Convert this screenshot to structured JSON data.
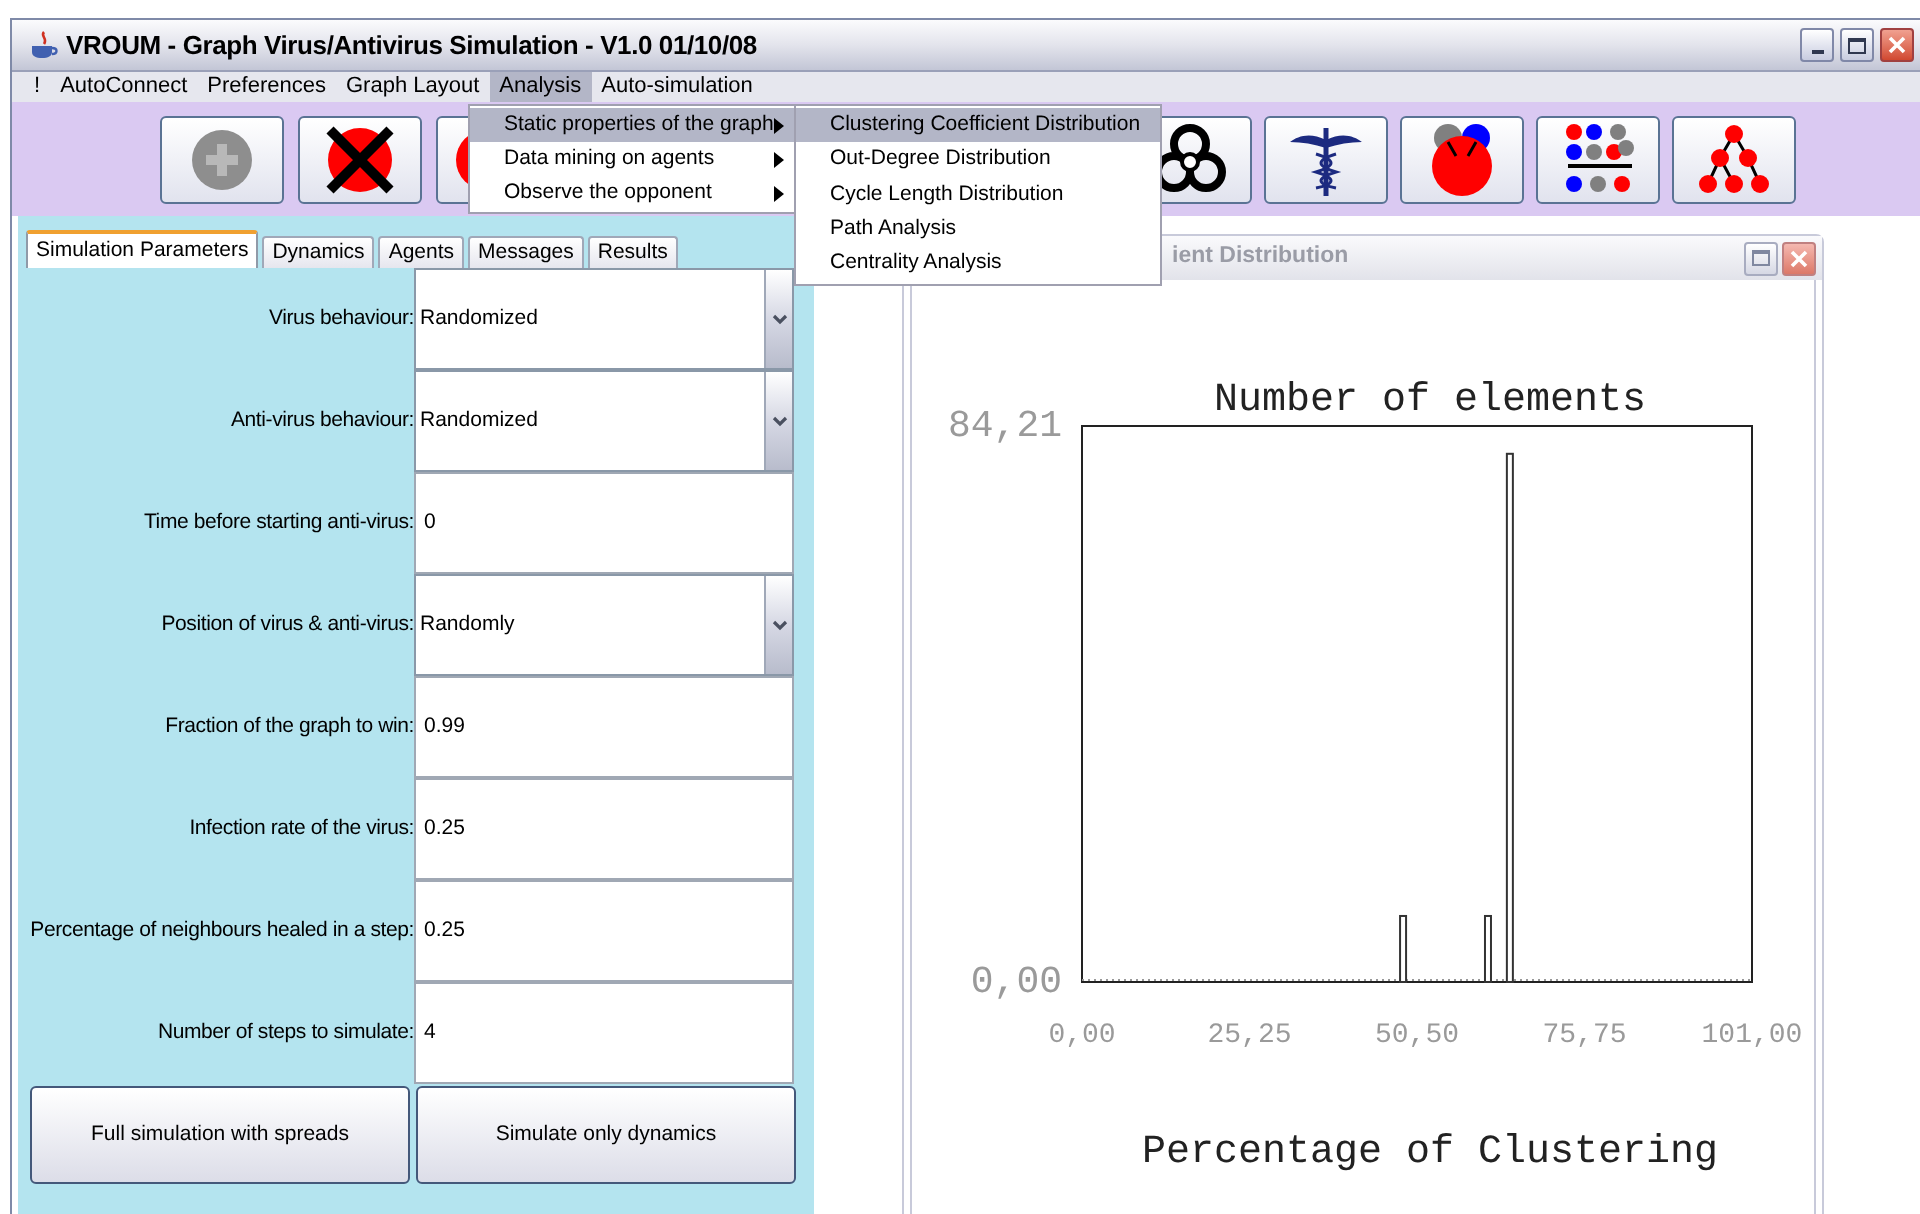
{
  "window": {
    "title": "VROUM - Graph Virus/Antivirus Simulation - V1.0 01/10/08"
  },
  "menu_bar": [
    {
      "label": "!",
      "selected": false
    },
    {
      "label": "AutoConnect",
      "selected": false
    },
    {
      "label": "Preferences",
      "selected": false
    },
    {
      "label": "Graph Layout",
      "selected": false
    },
    {
      "label": "Analysis",
      "selected": true
    },
    {
      "label": "Auto-simulation",
      "selected": false
    }
  ],
  "analysis_menu": [
    {
      "label": "Static properties of the graph",
      "selected": true,
      "submenu": true
    },
    {
      "label": "Data mining on agents",
      "selected": false,
      "submenu": true
    },
    {
      "label": "Observe the opponent",
      "selected": false,
      "submenu": true
    }
  ],
  "static_properties_submenu": [
    {
      "label": "Clustering Coefficient Distribution",
      "selected": true
    },
    {
      "label": "Out-Degree Distribution",
      "selected": false
    },
    {
      "label": "Cycle Length Distribution",
      "selected": false
    },
    {
      "label": "Path Analysis",
      "selected": false
    },
    {
      "label": "Centrality Analysis",
      "selected": false
    }
  ],
  "tabs": [
    {
      "label": "Simulation Parameters",
      "selected": true
    },
    {
      "label": "Dynamics",
      "selected": false
    },
    {
      "label": "Agents",
      "selected": false
    },
    {
      "label": "Messages",
      "selected": false
    },
    {
      "label": "Results",
      "selected": false
    }
  ],
  "fields": [
    {
      "label": "Virus behaviour:",
      "value": "Randomized",
      "kind": "dropdown"
    },
    {
      "label": "Anti-virus behaviour:",
      "value": "Randomized",
      "kind": "dropdown"
    },
    {
      "label": "Time before starting anti-virus:",
      "value": "0",
      "kind": "text"
    },
    {
      "label": "Position of virus & anti-virus:",
      "value": "Randomly",
      "kind": "dropdown"
    },
    {
      "label": "Fraction of the graph to win:",
      "value": "0.99",
      "kind": "text"
    },
    {
      "label": "Infection rate of the virus:",
      "value": "0.25",
      "kind": "text"
    },
    {
      "label": "Percentage of neighbours healed in a step:",
      "value": "0.25",
      "kind": "text"
    },
    {
      "label": "Number of steps to simulate:",
      "value": "4",
      "kind": "text"
    }
  ],
  "buttons": [
    "Full simulation with spreads",
    "Simulate only dynamics"
  ],
  "chart_window": {
    "title": "ient Distribution",
    "chart_data": {
      "type": "bar",
      "title": "Number of elements",
      "xlabel": "Percentage of Clustering",
      "x": [
        48.4,
        61.2,
        64.5
      ],
      "values": [
        10,
        10,
        80
      ],
      "xlim": [
        0,
        101
      ],
      "ylim": [
        0,
        84.21
      ],
      "xticks": [
        {
          "value": 0,
          "label": "0,00"
        },
        {
          "value": 25.25,
          "label": "25,25"
        },
        {
          "value": 50.5,
          "label": "50,50"
        },
        {
          "value": 75.75,
          "label": "75,75"
        },
        {
          "value": 101,
          "label": "101,00"
        }
      ],
      "yticks": [
        {
          "value": 0,
          "label": "0,00"
        },
        {
          "value": 84.21,
          "label": "84,21"
        }
      ]
    }
  }
}
